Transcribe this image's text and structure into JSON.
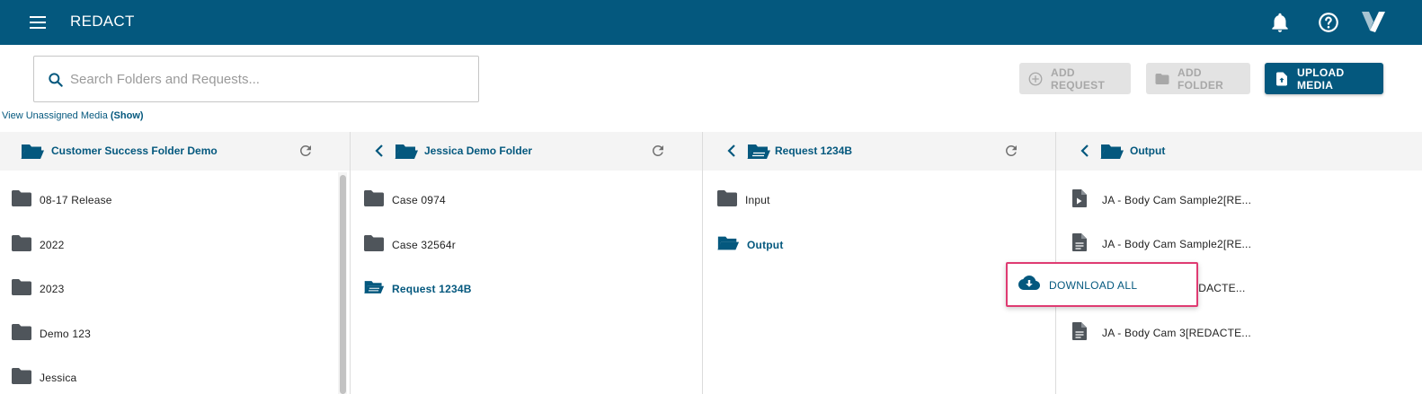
{
  "app": {
    "title": "REDACT",
    "brand_color": "#04587e",
    "highlight_color": "#df3b72"
  },
  "topbar": {
    "menu_icon": "hamburger-menu-icon",
    "right_icons": [
      "bell-icon",
      "help-icon",
      "brand-logo-icon"
    ]
  },
  "search": {
    "placeholder": "Search Folders and Requests...",
    "value": ""
  },
  "toolbar": {
    "add_request_label": "ADD REQUEST",
    "add_folder_label": "ADD FOLDER",
    "upload_media_label": "UPLOAD MEDIA"
  },
  "unassigned": {
    "text": "View Unassigned Media",
    "link": "(Show)"
  },
  "columns": [
    {
      "title": "Customer Success Folder Demo",
      "items": [
        {
          "label": "08-17 Release",
          "type": "folder"
        },
        {
          "label": "2022",
          "type": "folder"
        },
        {
          "label": "2023",
          "type": "folder"
        },
        {
          "label": "Demo 123",
          "type": "folder"
        },
        {
          "label": "Jessica",
          "type": "folder"
        }
      ]
    },
    {
      "title": "Jessica Demo Folder",
      "items": [
        {
          "label": "Case 0974",
          "type": "folder"
        },
        {
          "label": "Case 32564r",
          "type": "folder"
        },
        {
          "label": "Request 1234B",
          "type": "request",
          "active": true
        }
      ]
    },
    {
      "title": "Request 1234B",
      "items": [
        {
          "label": "Input",
          "type": "folder"
        },
        {
          "label": "Output",
          "type": "folder-open",
          "active": true
        }
      ]
    },
    {
      "title": "Output",
      "items": [
        {
          "label": "JA - Body Cam Sample2[RE...",
          "type": "file-video"
        },
        {
          "label": "JA - Body Cam Sample2[RE...",
          "type": "file"
        },
        {
          "label": "EDACTE...",
          "type": "file"
        },
        {
          "label": "JA - Body Cam 3[REDACTE...",
          "type": "file"
        }
      ]
    }
  ],
  "context_menu": {
    "download_all_label": "DOWNLOAD ALL",
    "icon": "cloud-download-icon"
  }
}
